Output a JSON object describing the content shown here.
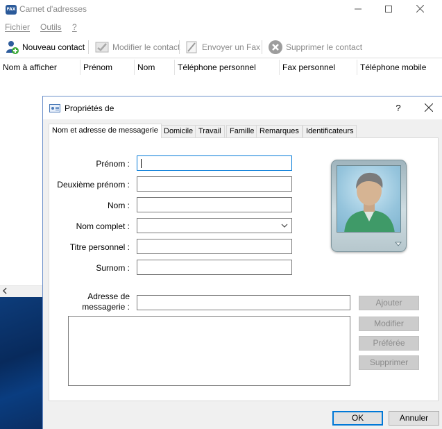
{
  "main": {
    "title": "Carnet d'adresses",
    "app_icon_text": "FAX",
    "menu": [
      "Fichier",
      "Outils",
      "?"
    ],
    "toolbar": {
      "new_contact": "Nouveau contact",
      "edit_contact": "Modifier le contact",
      "send_fax": "Envoyer un Fax",
      "delete_contact": "Supprimer le contact"
    },
    "columns": [
      "Nom à  afficher",
      "Prénom",
      "Nom",
      "Téléphone personnel",
      "Fax personnel",
      "Téléphone mobile"
    ]
  },
  "dialog": {
    "title": "Propriétés de",
    "help": "?",
    "tabs": [
      "Nom et adresse de messagerie",
      "Domicile",
      "Travail",
      "Famille",
      "Remarques",
      "Identificateurs"
    ],
    "fields": {
      "first_name": {
        "label": "Prénom :",
        "value": ""
      },
      "middle_name": {
        "label": "Deuxième prénom :",
        "value": ""
      },
      "last_name": {
        "label": "Nom :",
        "value": ""
      },
      "full_name": {
        "label": "Nom complet :",
        "value": ""
      },
      "personal_title": {
        "label": "Titre personnel :",
        "value": ""
      },
      "nickname": {
        "label": "Surnom :",
        "value": ""
      }
    },
    "email": {
      "label_line1": "Adresse de",
      "label_line2": "messagerie :",
      "value": "",
      "list": []
    },
    "buttons": {
      "add": "Ajouter",
      "edit": "Modifier",
      "preferred": "Préférée",
      "delete": "Supprimer",
      "ok": "OK",
      "cancel": "Annuler"
    }
  },
  "colors": {
    "focus_blue": "#0078d7",
    "disabled_text": "#8a8a8a",
    "dialog_bg": "#f0f0f0",
    "desktop_blue": "#0b3a78"
  }
}
